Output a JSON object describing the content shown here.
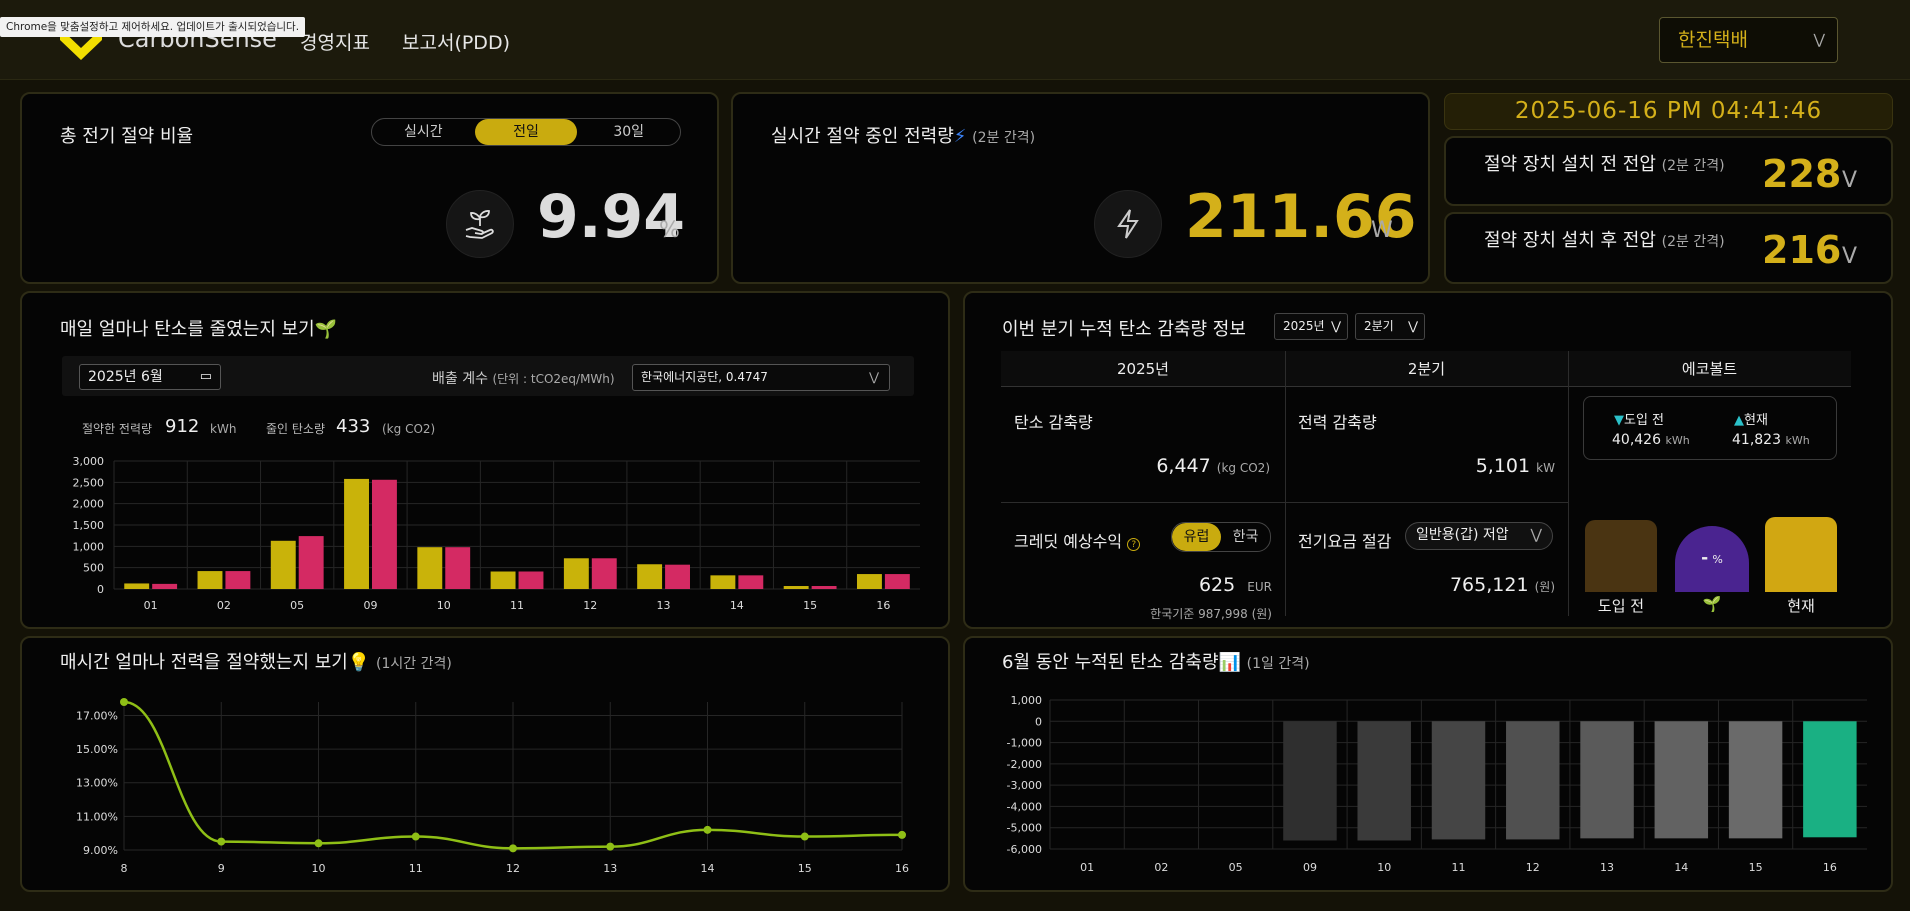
{
  "browser": {
    "notice": "Chrome을 맞춤설정하고 제어하세요. 업데이트가 출시되었습니다."
  },
  "header": {
    "logo_text": "CarbonSense",
    "nav": [
      "경영지표",
      "보고서(PDD)"
    ],
    "company": "한진택배",
    "accent": "#d4b01a"
  },
  "saving_ratio": {
    "title": "총 전기 절약 비율",
    "tabs": [
      "실시간",
      "전일",
      "30일"
    ],
    "active_tab": "전일",
    "value": "9.94",
    "unit": "%",
    "icon": "plant-hand-icon"
  },
  "realtime_power": {
    "title": "실시간 절약 중인 전력량",
    "interval": "(2분 간격)",
    "value": "211.66",
    "unit": "W",
    "icon": "lightning-icon"
  },
  "datetime": "2025-06-16 PM 04:41:46",
  "voltage": {
    "before": {
      "title": "절약 장치 설치 전 전압",
      "interval": "(2분 간격)",
      "value": "228",
      "unit": "V"
    },
    "after": {
      "title": "절약 장치 설치 후 전압",
      "interval": "(2분 간격)",
      "value": "216",
      "unit": "V"
    }
  },
  "daily_carbon": {
    "title": "매일 얼마나 탄소를 줄였는지 보기",
    "month_value": "2025년 6월",
    "emission_label": "배출 계수",
    "emission_unit": "(단위 : tCO2eq/MWh)",
    "emission_select": "한국에너지공단, 0.4747",
    "saved_power_label": "절약한 전력량",
    "saved_power_value": "912",
    "saved_power_unit": "kWh",
    "reduced_carbon_label": "줄인 탄소량",
    "reduced_carbon_value": "433",
    "reduced_carbon_unit": "(kg CO2)"
  },
  "quarter": {
    "title": "이번 분기 누적 탄소 감축량 정보",
    "year_select": "2025년",
    "quarter_select": "2분기",
    "col_headers": [
      "2025년",
      "2분기",
      "에코볼트"
    ],
    "carbon_label": "탄소 감축량",
    "carbon_value": "6,447",
    "carbon_unit": "(kg CO2)",
    "power_label": "전력 감축량",
    "power_value": "5,101",
    "power_unit": "kW",
    "credit_label": "크레딧 예상수익",
    "credit_help": "?",
    "credit_tabs": [
      "유럽",
      "한국"
    ],
    "credit_active": "유럽",
    "credit_value": "625",
    "credit_unit": "EUR",
    "credit_kr": "한국기준 987,998 (원)",
    "bill_label": "전기요금 절감",
    "bill_select": "일반용(갑) 저압",
    "bill_value": "765,121",
    "bill_unit": "(원)",
    "eco_before_label": "도입 전",
    "eco_before_value": "40,426",
    "eco_now_label": "현재",
    "eco_now_value": "41,823",
    "eco_unit": "kWh",
    "eco_pct": "-",
    "eco_pct_unit": "%",
    "eco_bar_before": "도입 전",
    "eco_bar_now": "현재"
  },
  "hourly": {
    "title": "매시간 얼마나 전력을 절약했는지 보기",
    "interval": "(1시간 간격)"
  },
  "monthly_cum": {
    "title": "6월 동안 누적된 탄소 감축량",
    "interval": "(1일 간격)"
  },
  "chart_data": [
    {
      "type": "bar",
      "categories": [
        "01",
        "02",
        "05",
        "09",
        "10",
        "11",
        "12",
        "13",
        "14",
        "15",
        "16"
      ],
      "series": [
        {
          "color": "#c9b30a",
          "values": [
            130,
            420,
            1130,
            2580,
            980,
            410,
            720,
            580,
            320,
            70,
            350
          ]
        },
        {
          "color": "#d42a63",
          "values": [
            120,
            420,
            1240,
            2560,
            980,
            410,
            720,
            570,
            320,
            70,
            350
          ]
        }
      ],
      "ylim": [
        0,
        3000
      ],
      "yticks": [
        "0",
        "500",
        "1,000",
        "1,500",
        "2,000",
        "2,500",
        "3,000"
      ],
      "grid": true
    },
    {
      "type": "line",
      "x": [
        "8",
        "9",
        "10",
        "11",
        "12",
        "13",
        "14",
        "15",
        "16"
      ],
      "values": [
        17.8,
        9.5,
        9.4,
        9.8,
        9.1,
        9.2,
        10.2,
        9.8,
        9.9
      ],
      "color": "#8fbf16",
      "ylim": [
        9.0,
        17.8
      ],
      "yticks": [
        "9.00%",
        "11.00%",
        "13.00%",
        "15.00%",
        "17.00%"
      ],
      "grid": true
    },
    {
      "type": "bar",
      "categories": [
        "01",
        "02",
        "05",
        "09",
        "10",
        "11",
        "12",
        "13",
        "14",
        "15",
        "16"
      ],
      "values": [
        0,
        0,
        0,
        -5600,
        -5600,
        -5550,
        -5550,
        -5500,
        -5500,
        -5500,
        -5450
      ],
      "colors": [
        "#2f2f2f",
        "#2f2f2f",
        "#2f2f2f",
        "#2f2f2f",
        "#3a3a3a",
        "#454545",
        "#505050",
        "#5a5a5a",
        "#626262",
        "#6a6a6a",
        "#1ab083"
      ],
      "ylim": [
        -6000,
        1000
      ],
      "yticks": [
        "1,000",
        "0",
        "-1,000",
        "-2,000",
        "-3,000",
        "-4,000",
        "-5,000",
        "-6,000"
      ],
      "grid": true
    }
  ]
}
